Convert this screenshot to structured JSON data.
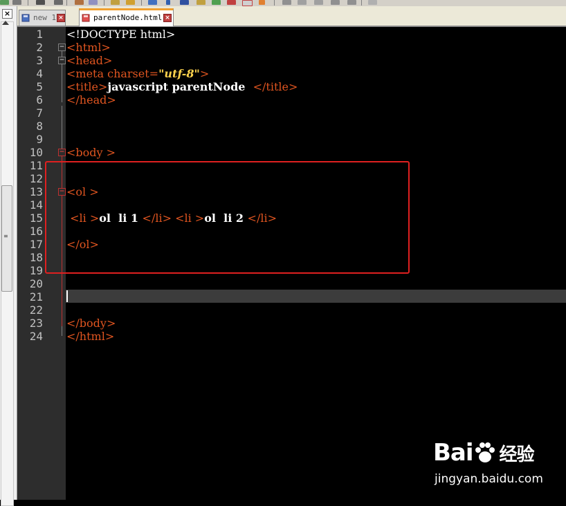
{
  "window": {
    "close_glyph": "×"
  },
  "tabs": [
    {
      "label": "new 1",
      "active": false,
      "close_glyph": "×"
    },
    {
      "label": "parentNode.html",
      "active": true,
      "close_glyph": "×"
    }
  ],
  "editor": {
    "current_line": 21,
    "lines": [
      {
        "n": "1"
      },
      {
        "n": "2"
      },
      {
        "n": "3"
      },
      {
        "n": "4"
      },
      {
        "n": "5"
      },
      {
        "n": "6"
      },
      {
        "n": "7"
      },
      {
        "n": "8"
      },
      {
        "n": "9"
      },
      {
        "n": "10"
      },
      {
        "n": "11"
      },
      {
        "n": "12"
      },
      {
        "n": "13"
      },
      {
        "n": "14"
      },
      {
        "n": "15"
      },
      {
        "n": "16"
      },
      {
        "n": "17"
      },
      {
        "n": "18"
      },
      {
        "n": "19"
      },
      {
        "n": "20"
      },
      {
        "n": "21"
      },
      {
        "n": "22"
      },
      {
        "n": "23"
      },
      {
        "n": "24"
      }
    ],
    "code": {
      "l1": "<!DOCTYPE html>",
      "l2_tag": "<html>",
      "l3_tag": "<head>",
      "l4_open": "<meta charset=",
      "l4_val": "\"utf-8\"",
      "l4_close": ">",
      "l5_open": "<title>",
      "l5_text": "javascript parentNode  ",
      "l5_close": "</title>",
      "l6_tag": "</head>",
      "l10_tag": "<body >",
      "l13_tag": "<ol >",
      "l15_li1_open": " <li >",
      "l15_li1_text": "ol  li 1 ",
      "l15_li1_close": "</li> ",
      "l15_li2_open": "<li >",
      "l15_li2_text": "ol  li 2 ",
      "l15_li2_close": "</li>",
      "l17_tag": "</ol>",
      "l23_tag": "</body>",
      "l24_tag": "</html>"
    }
  },
  "colors": {
    "tag": "#e05520",
    "string": "#ffd34d",
    "highlight_box": "#e02020",
    "gutter": "#2d2d2d"
  },
  "watermark": {
    "logo_text": "Bai",
    "logo_text_2": "",
    "logo_cn": "经验",
    "url": "jingyan.baidu.com"
  }
}
